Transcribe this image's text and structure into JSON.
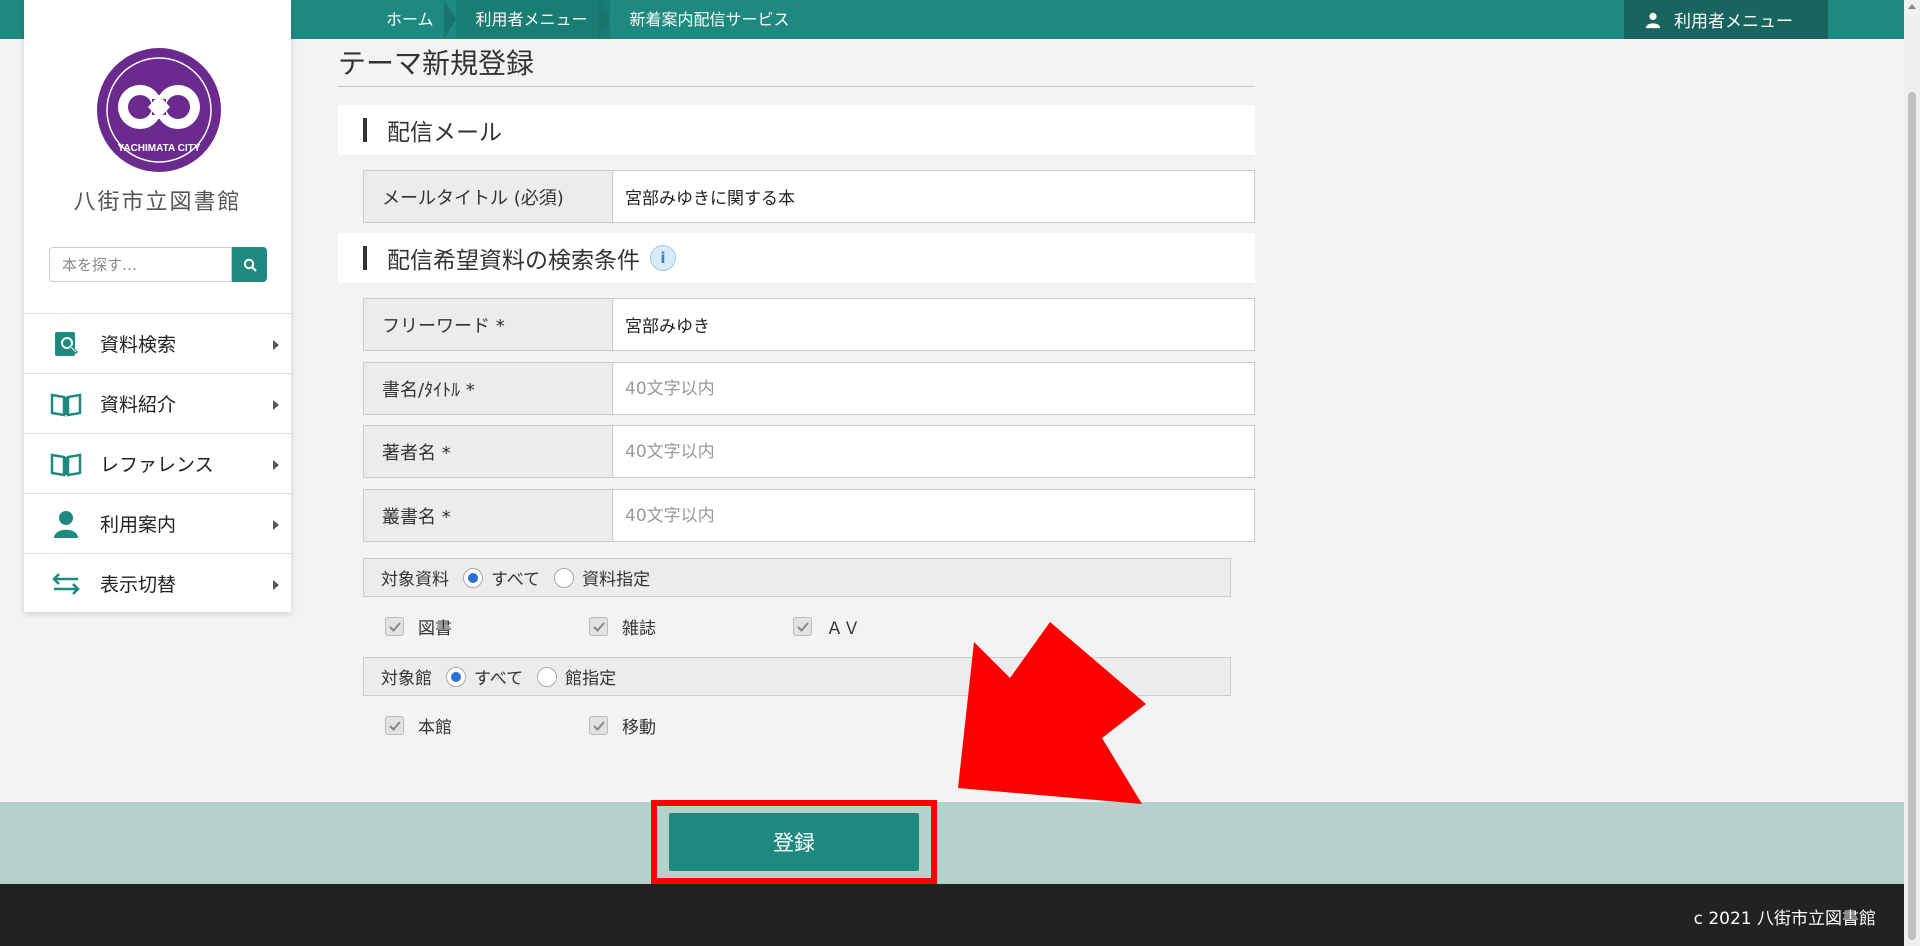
{
  "header": {
    "breadcrumbs": [
      "ホーム",
      "利用者メニュー",
      "新着案内配信サービス"
    ],
    "user_menu_label": "利用者メニュー"
  },
  "sidebar": {
    "logo_text": "YACHIMATA CITY",
    "library_name": "八街市立図書館",
    "search_placeholder": "本を探す…",
    "items": [
      {
        "label": "資料検索",
        "icon": "book-search-icon"
      },
      {
        "label": "資料紹介",
        "icon": "open-book-icon"
      },
      {
        "label": "レファレンス",
        "icon": "open-book-icon"
      },
      {
        "label": "利用案内",
        "icon": "person-icon"
      },
      {
        "label": "表示切替",
        "icon": "swap-arrows-icon"
      }
    ]
  },
  "page": {
    "title": "テーマ新規登録",
    "section1": "配信メール",
    "section2": "配信希望資料の検索条件",
    "fields": {
      "mail_title_label": "メールタイトル (必須)",
      "mail_title_value": "宮部みゆきに関する本",
      "freeword_label": "フリーワード *",
      "freeword_value": "宮部みゆき",
      "booktitle_label": "書名/ﾀｲﾄﾙ *",
      "booktitle_placeholder": "40文字以内",
      "author_label": "著者名 *",
      "author_placeholder": "40文字以内",
      "series_label": "叢書名 *",
      "series_placeholder": "40文字以内"
    },
    "target_material": {
      "label": "対象資料",
      "opt_all": "すべて",
      "opt_specify": "資料指定",
      "selected": "すべて",
      "checks": [
        "図書",
        "雑誌",
        "ＡＶ"
      ]
    },
    "target_library": {
      "label": "対象館",
      "opt_all": "すべて",
      "opt_specify": "館指定",
      "selected": "すべて",
      "checks": [
        "本館",
        "移動"
      ]
    }
  },
  "actions": {
    "submit_label": "登録"
  },
  "footer": {
    "copyright": "c 2021 八街市立図書館"
  },
  "colors": {
    "brand": "#1e8a7f",
    "highlight": "#ff0000",
    "action_bar": "#b6d1cc",
    "logo": "#6a2a8e"
  }
}
